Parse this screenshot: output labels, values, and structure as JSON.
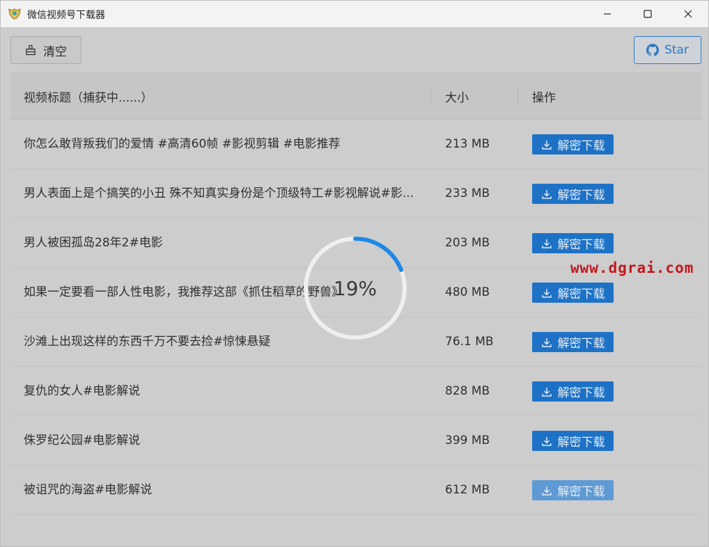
{
  "window": {
    "title": "微信视频号下载器",
    "controls": {
      "minimize": "—",
      "maximize": "☐",
      "close": "✕"
    }
  },
  "toolbar": {
    "clear_label": "清空",
    "star_label": "Star"
  },
  "table": {
    "headers": {
      "title": "视频标题（捕获中......）",
      "size": "大小",
      "action": "操作"
    },
    "download_label": "解密下载",
    "rows": [
      {
        "title": "你怎么敢背叛我们的爱情 #高清60帧 #影视剪辑 #电影推荐",
        "size": "213 MB"
      },
      {
        "title": "男人表面上是个搞笑的小丑 殊不知真实身份是个顶级特工#影视解说#影...",
        "size": "233 MB"
      },
      {
        "title": "男人被困孤岛28年2#电影",
        "size": "203 MB"
      },
      {
        "title": "如果一定要看一部人性电影，我推荐这部《抓住稻草的野兽》",
        "size": "480 MB"
      },
      {
        "title": "沙滩上出现这样的东西千万不要去捡#惊悚悬疑",
        "size": "76.1 MB"
      },
      {
        "title": "复仇的女人#电影解说",
        "size": "828 MB"
      },
      {
        "title": "侏罗纪公园#电影解说",
        "size": "399 MB"
      },
      {
        "title": "被诅咒的海盗#电影解说",
        "size": "612 MB"
      }
    ]
  },
  "progress": {
    "text": "19%",
    "value": 0.19,
    "color": "#1e88e5"
  },
  "watermark": "www.dgrai.com",
  "colors": {
    "primary": "#1d72c6",
    "star_border": "#2f7ac6",
    "watermark": "#c4161c"
  }
}
